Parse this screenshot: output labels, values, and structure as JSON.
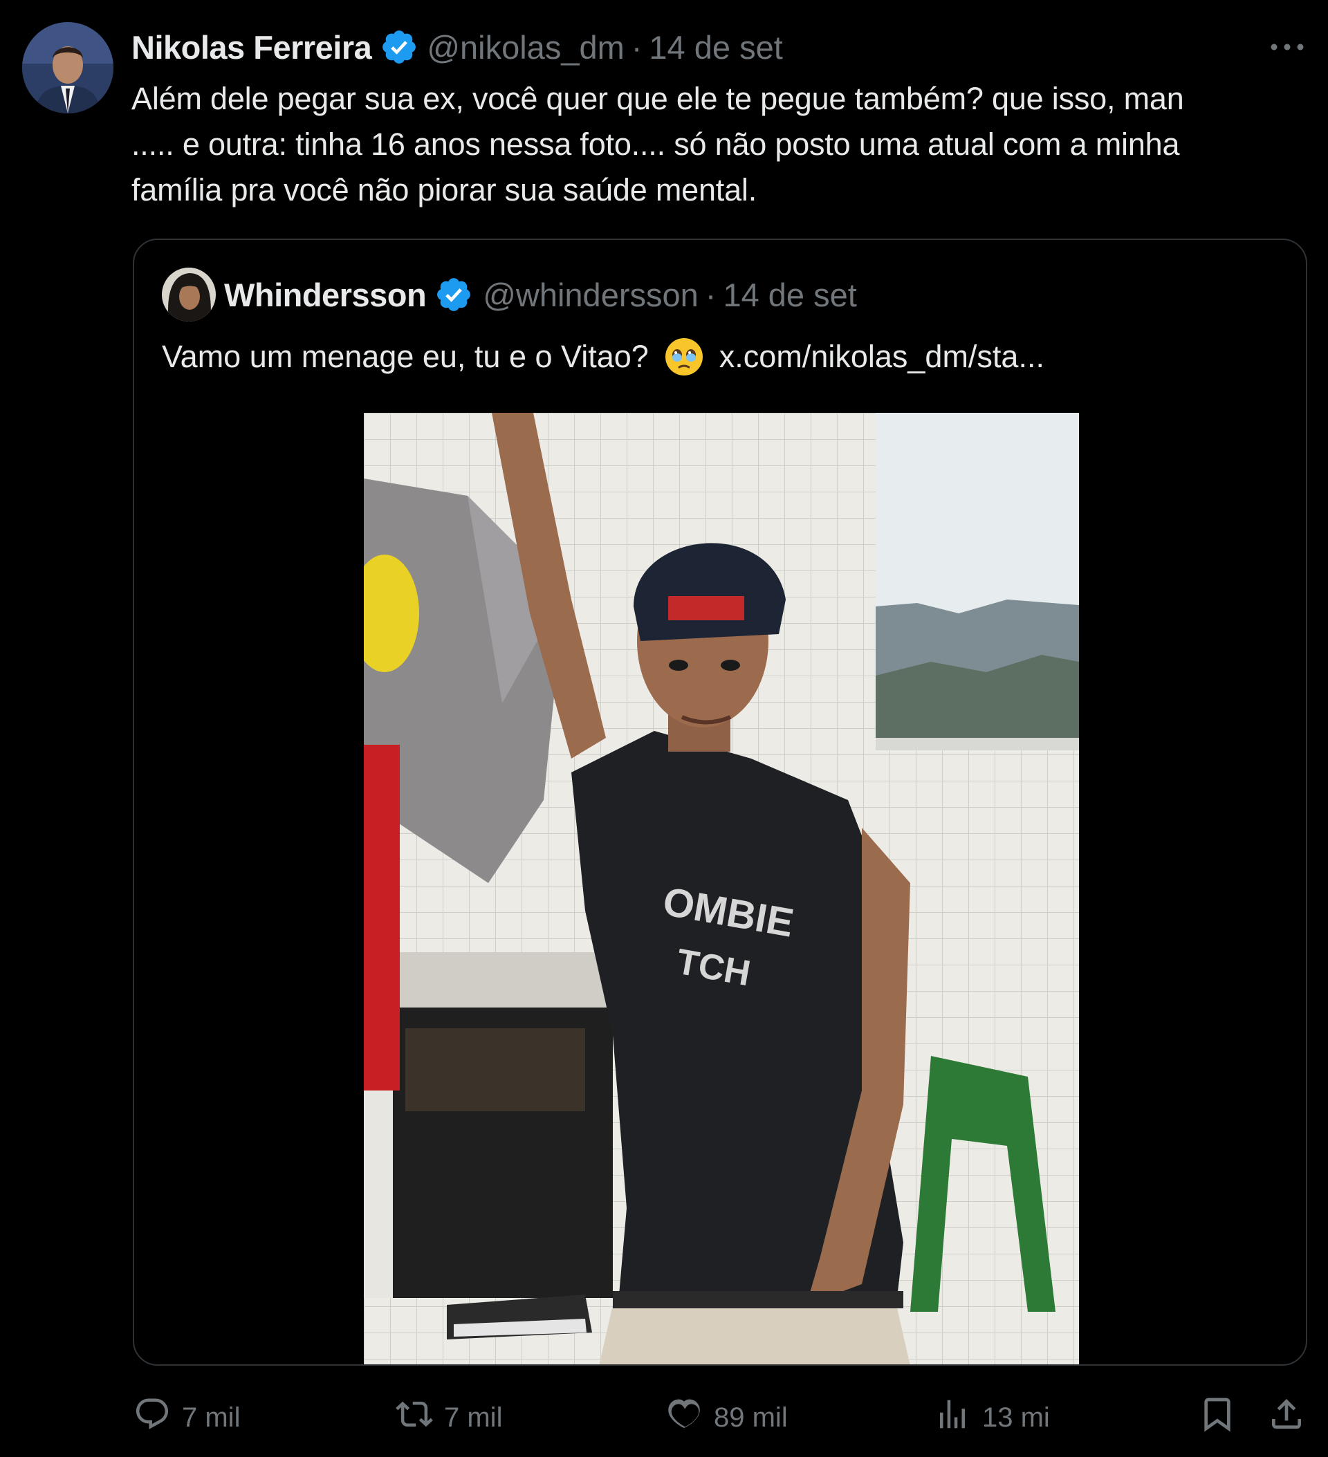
{
  "tweet": {
    "author_name": "Nikolas Ferreira",
    "author_handle": "@nikolas_dm",
    "separator": "·",
    "date": "14 de set",
    "text_line1": "Além dele pegar sua ex, você quer que ele te pegue também? que isso, man",
    "text_line2": "..... e outra: tinha 16 anos nessa foto.... só não posto uma atual com a minha",
    "text_line3": "família pra você não piorar sua saúde mental."
  },
  "quoted": {
    "author_name": "Whindersson",
    "author_handle": "@whindersson",
    "separator": "·",
    "date": "14 de set",
    "text": "Vamo um menage eu, tu e o Vitao?",
    "link": "x.com/nikolas_dm/sta..."
  },
  "actions": {
    "replies": "7 mil",
    "reposts": "7 mil",
    "likes": "89 mil",
    "views": "13 mi"
  },
  "icons": {
    "verified": "verified-badge-icon",
    "more": "more-icon",
    "reply": "reply-icon",
    "repost": "repost-icon",
    "like": "like-icon",
    "views": "views-icon",
    "bookmark": "bookmark-icon",
    "share": "share-icon",
    "emoji": "teary-face-emoji"
  },
  "colors": {
    "background": "#000000",
    "text": "#e7e9ea",
    "muted": "#71767b",
    "verified": "#1d9bf0",
    "border": "#2f3336"
  }
}
